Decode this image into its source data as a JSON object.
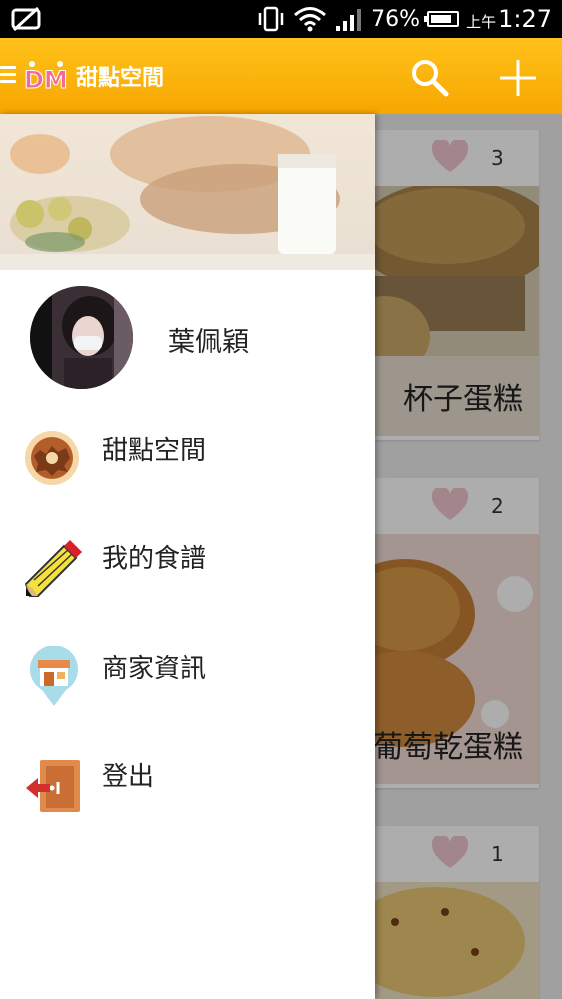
{
  "status_bar": {
    "battery": "76%",
    "time_prefix": "上午",
    "time": "1:27"
  },
  "app_bar": {
    "title": "甜點空間",
    "logo_text": "DM",
    "search_icon": "search-icon",
    "add_icon": "plus-icon"
  },
  "drawer": {
    "user_name": "葉佩穎",
    "menu": [
      {
        "label": "甜點空間",
        "icon": "donut-icon"
      },
      {
        "label": "我的食譜",
        "icon": "pencil-icon"
      },
      {
        "label": "商家資訊",
        "icon": "store-pin-icon"
      },
      {
        "label": "登出",
        "icon": "logout-door-icon"
      }
    ]
  },
  "feed": {
    "cards": [
      {
        "likes": "3",
        "title": "杯子蛋糕"
      },
      {
        "likes": "2",
        "title": "葡萄乾蛋糕"
      },
      {
        "likes": "1",
        "title": ""
      }
    ]
  },
  "colors": {
    "app_bar": "#f7a700",
    "heart": "#f0c6cf"
  }
}
